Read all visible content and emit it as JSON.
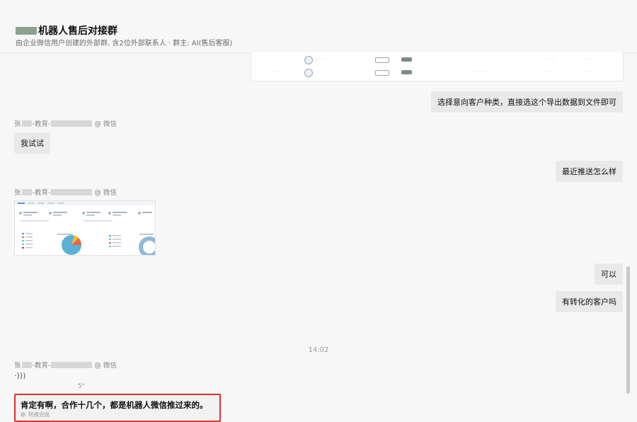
{
  "header": {
    "title": "机器人售后对接群",
    "subtitle": "由企业微信用户创建的外部群, 含2位外部联系人 · 群主: AI(售后客服)"
  },
  "messages": {
    "outgoing_1": "选择意向客户种类，直接选这个导出数据到文件即可",
    "sender_1": {
      "prefix": "张",
      "mid": "-教育-",
      "suffix": "@ 微信"
    },
    "incoming_1": "我试试",
    "outgoing_2": "最近推送怎么样",
    "sender_2": {
      "prefix": "张",
      "mid": "-教育-",
      "suffix": "@ 微信"
    },
    "outgoing_3": "可以",
    "outgoing_4": "有转化的客户吗",
    "timestamp": "14:02",
    "sender_3": {
      "prefix": "张",
      "mid": "-教育-",
      "suffix": "@ 微信"
    },
    "voice_duration": "5\"",
    "highlighted": {
      "text": "肯定有啊，合作十几个，都是机器人微信推过来的。",
      "status": "转换完成"
    }
  },
  "colors": {
    "highlight_border": "#d9322e",
    "bubble": "#e9e9e9",
    "background": "#f7f7f7"
  }
}
